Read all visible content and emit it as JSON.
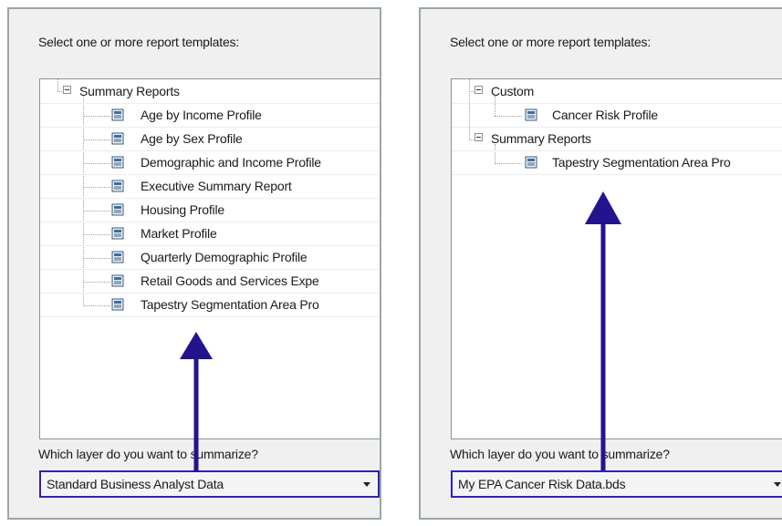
{
  "left_panel": {
    "prompt": "Select one or more report templates:",
    "tree": {
      "group": "Summary Reports",
      "items": [
        "Age by Income Profile",
        "Age by Sex Profile",
        "Demographic and Income Profile",
        "Executive Summary Report",
        "Housing Profile",
        "Market Profile",
        "Quarterly Demographic Profile",
        "Retail Goods and Services Expe",
        "Tapestry Segmentation Area Pro"
      ]
    },
    "question": "Which layer do you want to summarize?",
    "layer_value": "Standard Business Analyst Data"
  },
  "right_panel": {
    "prompt": "Select one or more report templates:",
    "tree": {
      "groups": [
        {
          "label": "Custom",
          "items": [
            "Cancer Risk Profile"
          ]
        },
        {
          "label": "Summary Reports",
          "items": [
            "Tapestry Segmentation Area Pro"
          ]
        }
      ]
    },
    "question": "Which layer do you want to summarize?",
    "layer_value": "My EPA Cancer Risk Data.bds"
  },
  "icons": {
    "expander": "collapse-minus-icon",
    "report": "report-document-icon",
    "dropdown": "chevron-down-icon",
    "annotation": "arrow-up-icon"
  },
  "colors": {
    "highlight_border": "#2d22b8",
    "annotation_arrow": "#24138f",
    "panel_background": "#f0f0f0"
  }
}
